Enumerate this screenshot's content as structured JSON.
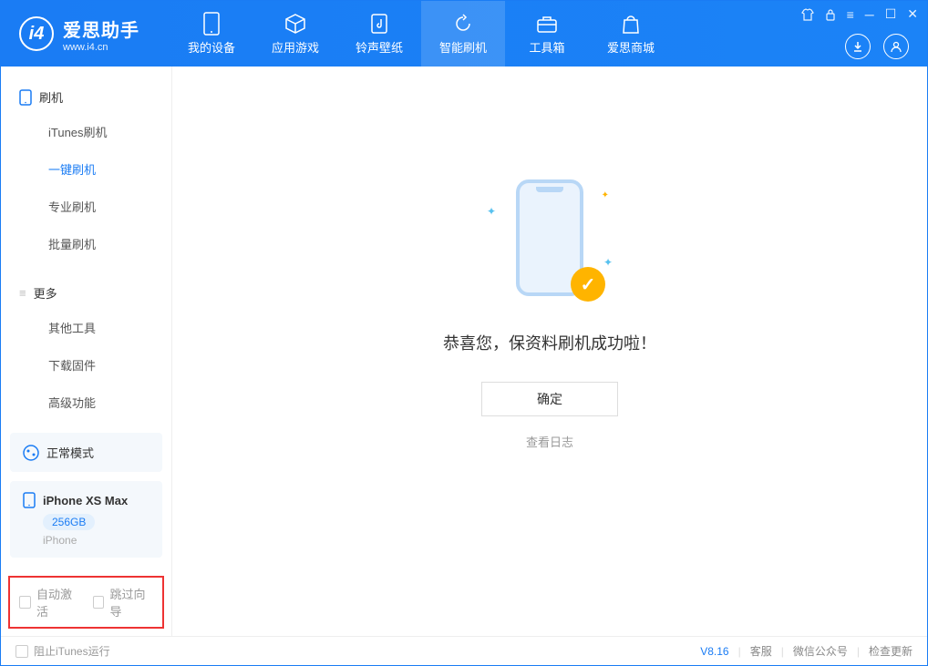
{
  "app": {
    "name": "爱思助手",
    "url": "www.i4.cn"
  },
  "nav": {
    "device": "我的设备",
    "apps": "应用游戏",
    "ringtone": "铃声壁纸",
    "flash": "智能刷机",
    "toolbox": "工具箱",
    "store": "爱思商城"
  },
  "sidebar": {
    "section1": {
      "title": "刷机",
      "items": [
        "iTunes刷机",
        "一键刷机",
        "专业刷机",
        "批量刷机"
      ]
    },
    "section2": {
      "title": "更多",
      "items": [
        "其他工具",
        "下载固件",
        "高级功能"
      ]
    }
  },
  "mode_panel": {
    "label": "正常模式"
  },
  "device_panel": {
    "name": "iPhone XS Max",
    "storage": "256GB",
    "type": "iPhone"
  },
  "opts": {
    "auto_activate": "自动激活",
    "skip_guide": "跳过向导"
  },
  "main": {
    "success": "恭喜您，保资料刷机成功啦！",
    "confirm": "确定",
    "view_log": "查看日志"
  },
  "footer": {
    "block_itunes": "阻止iTunes运行",
    "version": "V8.16",
    "support": "客服",
    "wechat": "微信公众号",
    "update": "检查更新"
  }
}
